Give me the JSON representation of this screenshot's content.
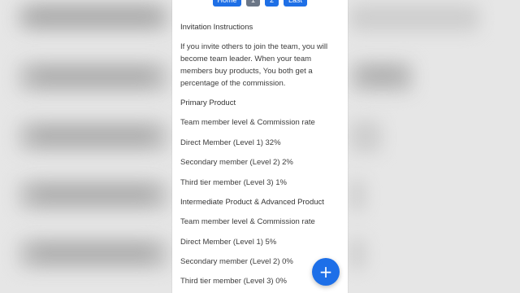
{
  "pager": {
    "home": "Home",
    "page1": "1",
    "page2": "2",
    "last": "Last"
  },
  "invitation": {
    "title": "Invitation Instructions",
    "body": "If you invite others to join the team, you will become team leader. When your team members buy products, You both get a percentage of the commission."
  },
  "primary": {
    "title": "Primary Product",
    "header": "Team member level & Commission rate",
    "rows": [
      "Direct Member (Level 1) 32%",
      "Secondary member (Level 2) 2%",
      "Third tier member (Level 3) 1%"
    ]
  },
  "intermediate": {
    "title": "Intermediate Product & Advanced Product",
    "header": "Team member level & Commission rate",
    "rows": [
      "Direct Member (Level 1) 5%",
      "Secondary member (Level 2) 0%",
      "Third tier member (Level 3) 0%"
    ]
  },
  "fab": {
    "icon": "plus-icon",
    "glyph": "+"
  },
  "colors": {
    "primary": "#1e6fe6",
    "disabled": "#6b7686",
    "text": "#3c3c3c"
  }
}
